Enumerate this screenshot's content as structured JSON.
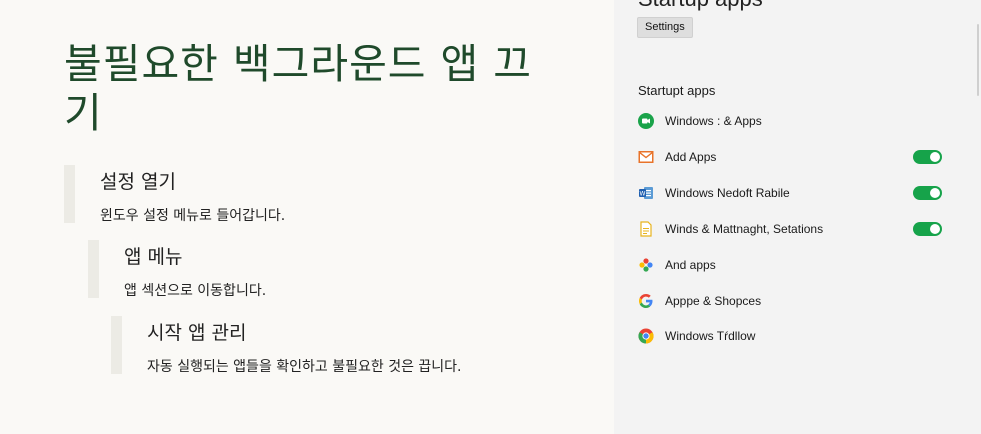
{
  "article": {
    "headline": "불필요한 백그라운드 앱 끄기",
    "steps": [
      {
        "title": "설정 열기",
        "desc": "윈도우 설정 메뉴로 들어갑니다."
      },
      {
        "title": "앱 메뉴",
        "desc": "앱 섹션으로 이동합니다."
      },
      {
        "title": "시작 앱 관리",
        "desc": "자동 실행되는 앱들을 확인하고 불필요한 것은 끕니다."
      }
    ]
  },
  "settings_panel": {
    "title": "Startup apps",
    "settings_button": "Settings",
    "section_title": "Startupt apps",
    "apps": [
      {
        "name": "Windows : & Apps",
        "icon": "video-call-icon",
        "toggle": null
      },
      {
        "name": "Add Apps",
        "icon": "mail-icon",
        "toggle": "on"
      },
      {
        "name": "Windows Nedoft Rabile",
        "icon": "office-icon",
        "toggle": "on"
      },
      {
        "name": "Winds & Mattnaght, Setations",
        "icon": "notes-icon",
        "toggle": "on"
      },
      {
        "name": "And apps",
        "icon": "photos-icon",
        "toggle": null
      },
      {
        "name": "Apppe & Shopces",
        "icon": "google-icon",
        "toggle": null
      },
      {
        "name": "Windows Tŕdllow",
        "icon": "chrome-icon",
        "toggle": null
      }
    ],
    "colors": {
      "toggle_on": "#16a34a",
      "headline": "#1f4a2b"
    }
  }
}
